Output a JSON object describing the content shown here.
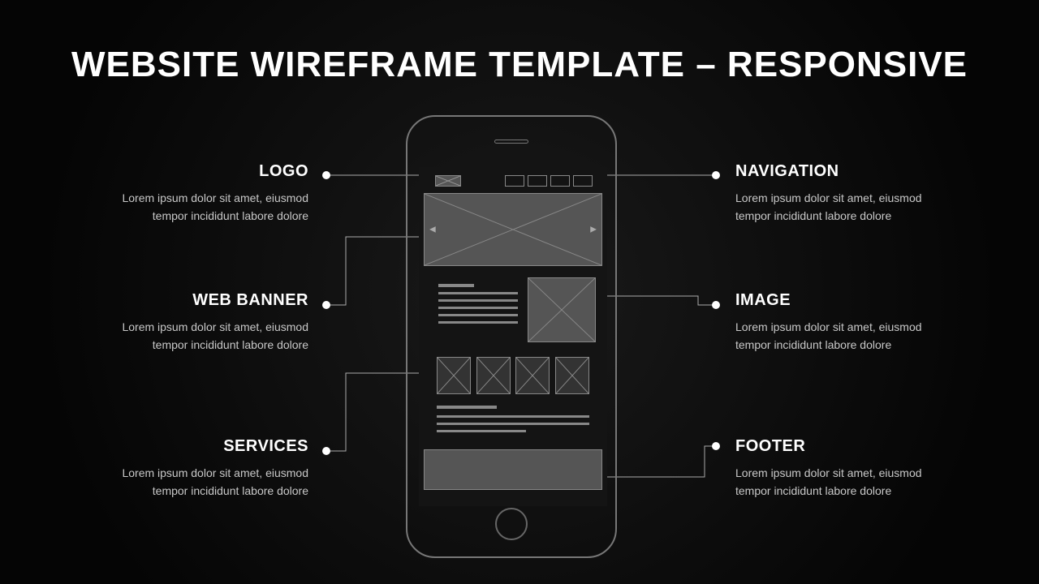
{
  "title": "WEBSITE WIREFRAME TEMPLATE – RESPONSIVE",
  "callouts": {
    "logo": {
      "title": "LOGO",
      "body": "Lorem ipsum dolor sit amet, eiusmod tempor incididunt labore dolore"
    },
    "webbanner": {
      "title": "WEB BANNER",
      "body": "Lorem ipsum dolor sit amet, eiusmod tempor incididunt labore dolore"
    },
    "services": {
      "title": "SERVICES",
      "body": "Lorem ipsum dolor sit amet, eiusmod tempor incididunt labore dolore"
    },
    "navigation": {
      "title": "NAVIGATION",
      "body": "Lorem ipsum dolor sit amet, eiusmod tempor incididunt labore dolore"
    },
    "image": {
      "title": "IMAGE",
      "body": "Lorem ipsum dolor sit amet, eiusmod tempor incididunt labore dolore"
    },
    "footer": {
      "title": "FOOTER",
      "body": "Lorem ipsum dolor sit amet, eiusmod tempor incididunt labore dolore"
    }
  }
}
